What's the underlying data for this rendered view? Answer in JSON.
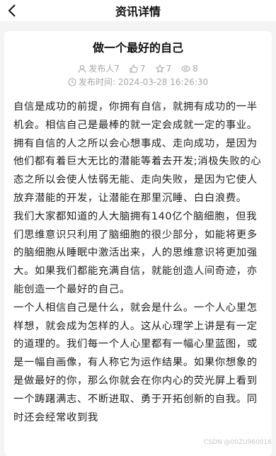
{
  "header": {
    "title": "资讯详情"
  },
  "article": {
    "title": "做一个最好的自己",
    "meta": {
      "publisher": "发布人7",
      "likes": "7",
      "favorites": "7",
      "views": "8",
      "publish_time": "发布时间:  2024-03-28 16:26:30"
    },
    "paragraphs": [
      "自信是成功的前提，你拥有自信，就拥有成功的一半机会。相信自己是最棒的就一定会成就一定的事业。拥有自信的人之所以会心想事成、走向成功，是因为他们都有着巨大无比的潜能等着去开发;消极失败的心态之所以会使人怯弱无能、走向失败，是因为它使人放弃潜能的开发，让潜能在那里沉睡、白白浪费。",
      "我们大家都知道的人大脑拥有140亿个脑细胞，但我们思维意识只利用了脑细胞的很少部分，如能将更多的脑细胞从睡眠中激活出来，人的思维意识将更加强大。如果我们都能充满自信，就能创造人间奇迹，亦能创造一个最好的自己。",
      "一个人相信自己是什么，就会是什么。一个人心里怎样想，就会成为怎样的人。这从心理学上讲是有一定的道理的。我们每一个人心里都有一幅心里蓝图，或是一幅自画像，有人称它为运作结果。如果你想象的是做最好的你，那么你就会在你内心的荧光屏上看到一个踌躇满志、不断进取、勇于开拓创新的自我。同时还会经常收到我"
    ]
  },
  "watermark": "CSDN @00ZU960016"
}
